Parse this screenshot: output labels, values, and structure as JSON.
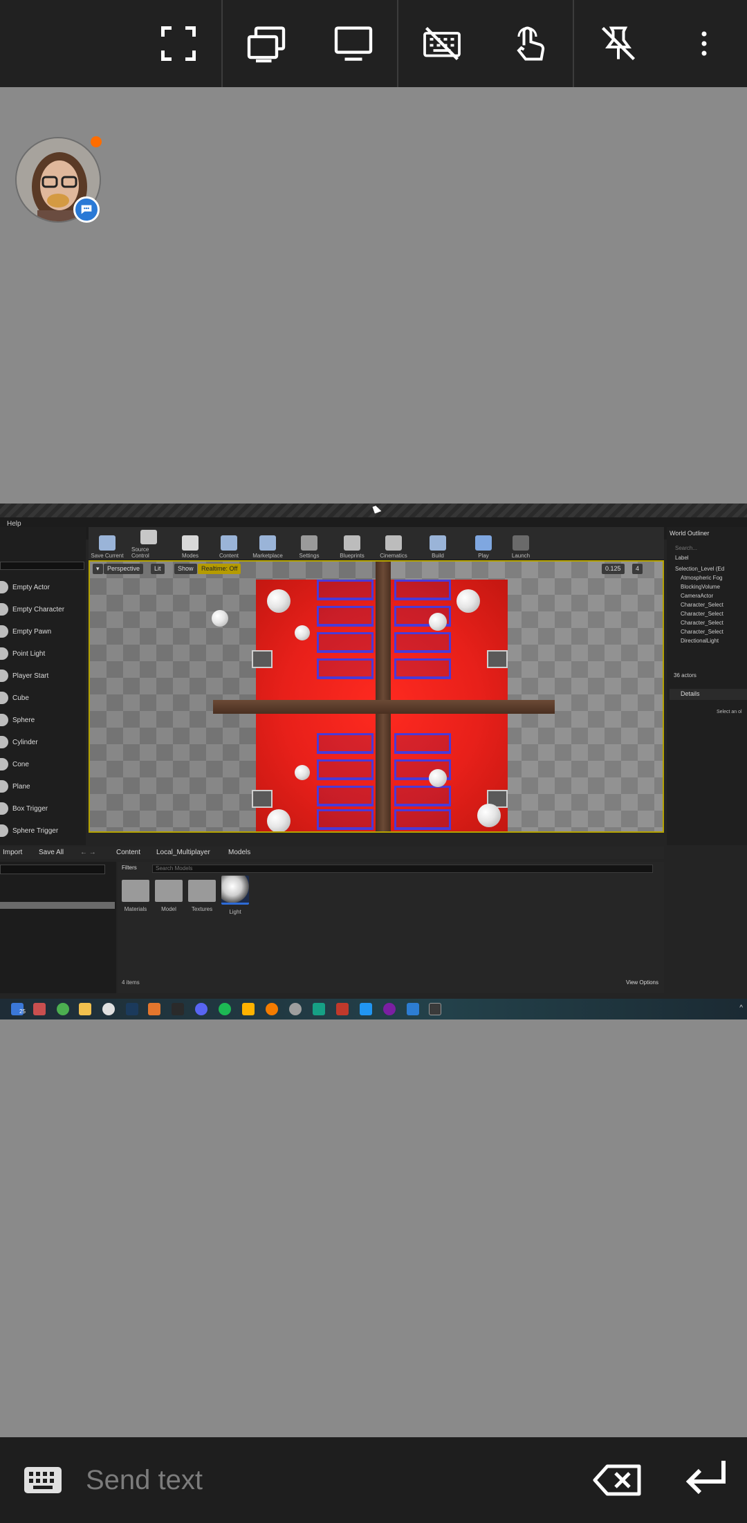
{
  "toolbar": {
    "icons": [
      "fullscreen-icon",
      "switch-monitor-icon",
      "single-monitor-icon",
      "keyboard-off-icon",
      "touch-icon",
      "unpin-icon",
      "more-vert-icon"
    ]
  },
  "remote_screen": {
    "menu_help": "Help",
    "place_items": [
      "Empty Actor",
      "Empty Character",
      "Empty Pawn",
      "Point Light",
      "Player Start",
      "Cube",
      "Sphere",
      "Cylinder",
      "Cone",
      "Plane",
      "Box Trigger",
      "Sphere Trigger"
    ],
    "toolbar_items": [
      "Save Current",
      "Source Control",
      "Modes",
      "Content",
      "Marketplace",
      "Settings",
      "Blueprints",
      "Cinematics",
      "Build",
      "Play",
      "Launch"
    ],
    "viewport": {
      "perspective": "Perspective",
      "lit": "Lit",
      "show": "Show",
      "realtime": "Realtime: Off",
      "snap_value": "0.125",
      "camera_speed": "4"
    },
    "outliner": {
      "title": "World Outliner",
      "search_placeholder": "Search...",
      "label_header": "Label",
      "rows": [
        "Selection_Level (Ed",
        "Atmospheric Fog",
        "BlockingVolume",
        "CameraActor",
        "Character_Select",
        "Character_Select",
        "Character_Select",
        "Character_Select",
        "DirectionalLight"
      ],
      "count": "36 actors",
      "details": "Details",
      "select_hint": "Select an ol"
    },
    "content_browser": {
      "import": "Import",
      "save_all": "Save All",
      "path": [
        "Content",
        "Local_Multiplayer",
        "Models"
      ],
      "filters": "Filters",
      "search_placeholder": "Search Models",
      "assets": [
        "Materials",
        "Model",
        "Textures",
        "Light"
      ],
      "items_count": "4 items",
      "view_options": "View Options"
    },
    "taskbar_badge": "25"
  },
  "send": {
    "placeholder": "Send text"
  },
  "colors": {
    "topbar": "#212121",
    "background": "#8a8a8a",
    "status_dot": "#ff6d00",
    "chat_badge": "#2979d6"
  }
}
